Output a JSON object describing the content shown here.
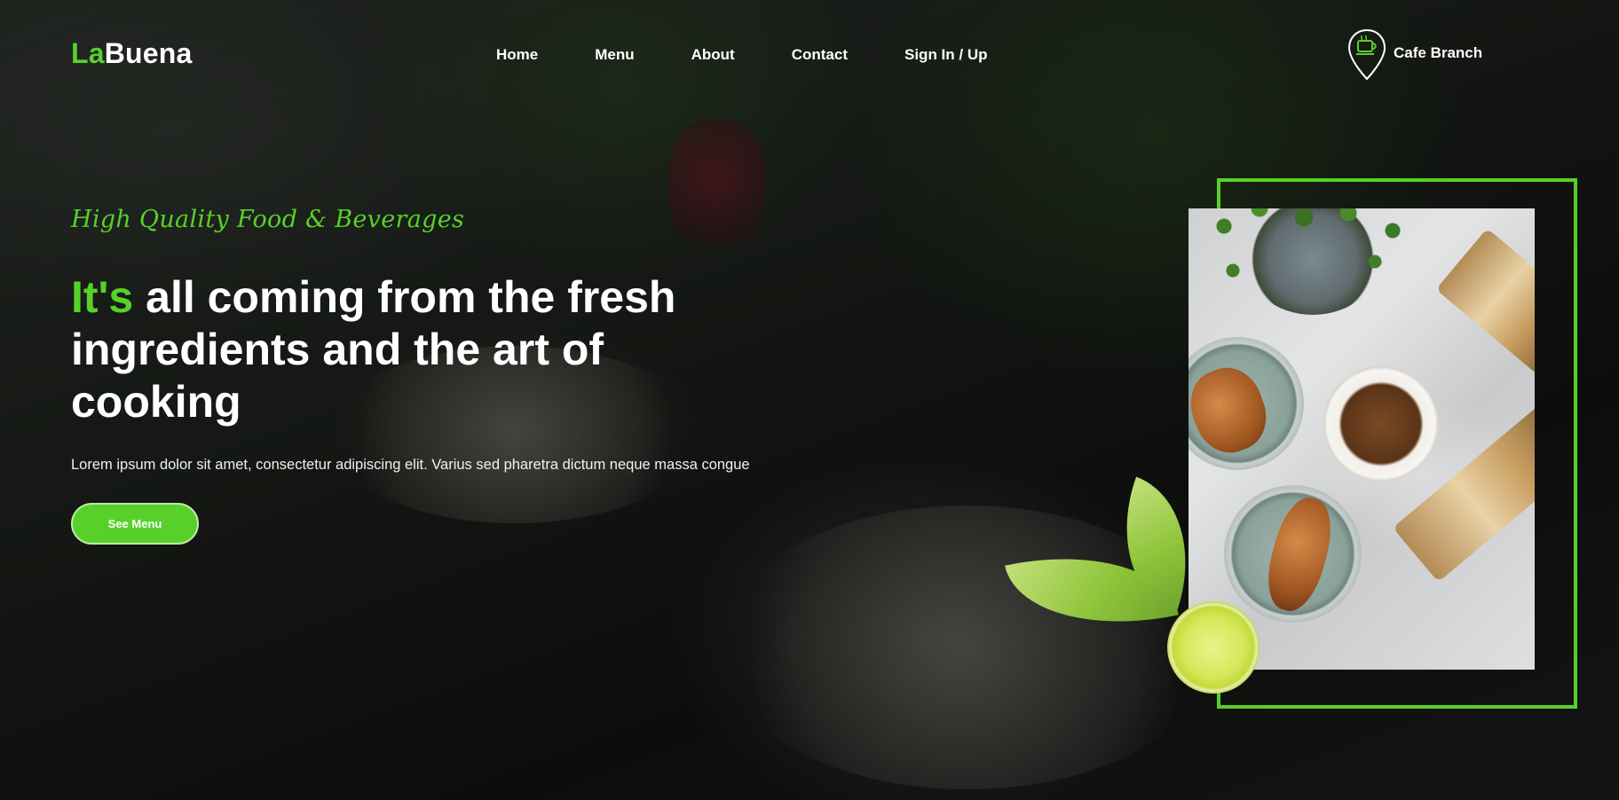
{
  "brand": {
    "prefix": "La",
    "suffix": "Buena"
  },
  "nav": {
    "items": [
      "Home",
      "Menu",
      "About",
      "Contact",
      "Sign In / Up"
    ]
  },
  "branch": {
    "label": "Cafe Branch",
    "icon": "map-pin-coffee-icon"
  },
  "hero": {
    "tagline": "High Quality Food & Beverages",
    "headline_accent": "It's",
    "headline_rest": " all coming from the fresh ingredients and the art of cooking",
    "description": "Lorem ipsum dolor sit amet, consectetur adipiscing elit. Varius sed pharetra dictum neque massa congue",
    "cta_label": "See Menu"
  },
  "colors": {
    "accent": "#57d12a",
    "text": "#ffffff",
    "background_overlay": "#151815"
  }
}
